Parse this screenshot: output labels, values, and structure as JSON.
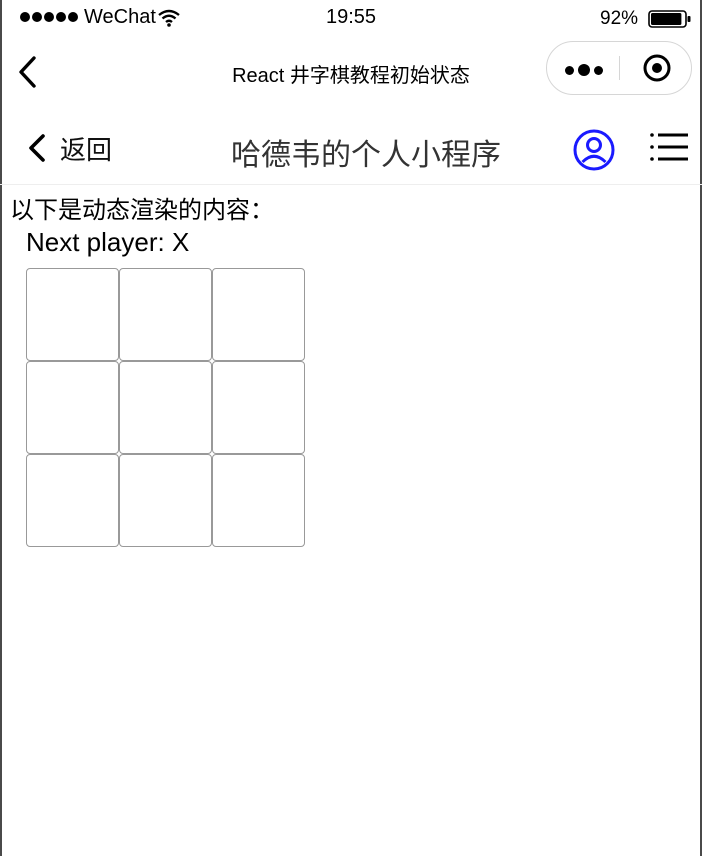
{
  "status_bar": {
    "carrier": "WeChat",
    "time": "19:55",
    "battery_percent": "92%",
    "battery_level": 0.92
  },
  "nav_bar": {
    "title": "React 井字棋教程初始状态",
    "more_icon": "more-dots-icon",
    "close_icon": "target-close-icon"
  },
  "app_header": {
    "back_label": "返回",
    "title": "哈德韦的个人小程序",
    "user_icon": "user-icon",
    "menu_icon": "menu-icon",
    "accent_color": "#1a1aff"
  },
  "content": {
    "intro_text": "以下是动态渲染的内容：",
    "status_text": "Next player: X",
    "board": [
      [
        "",
        "",
        ""
      ],
      [
        "",
        "",
        ""
      ],
      [
        "",
        "",
        ""
      ]
    ]
  }
}
